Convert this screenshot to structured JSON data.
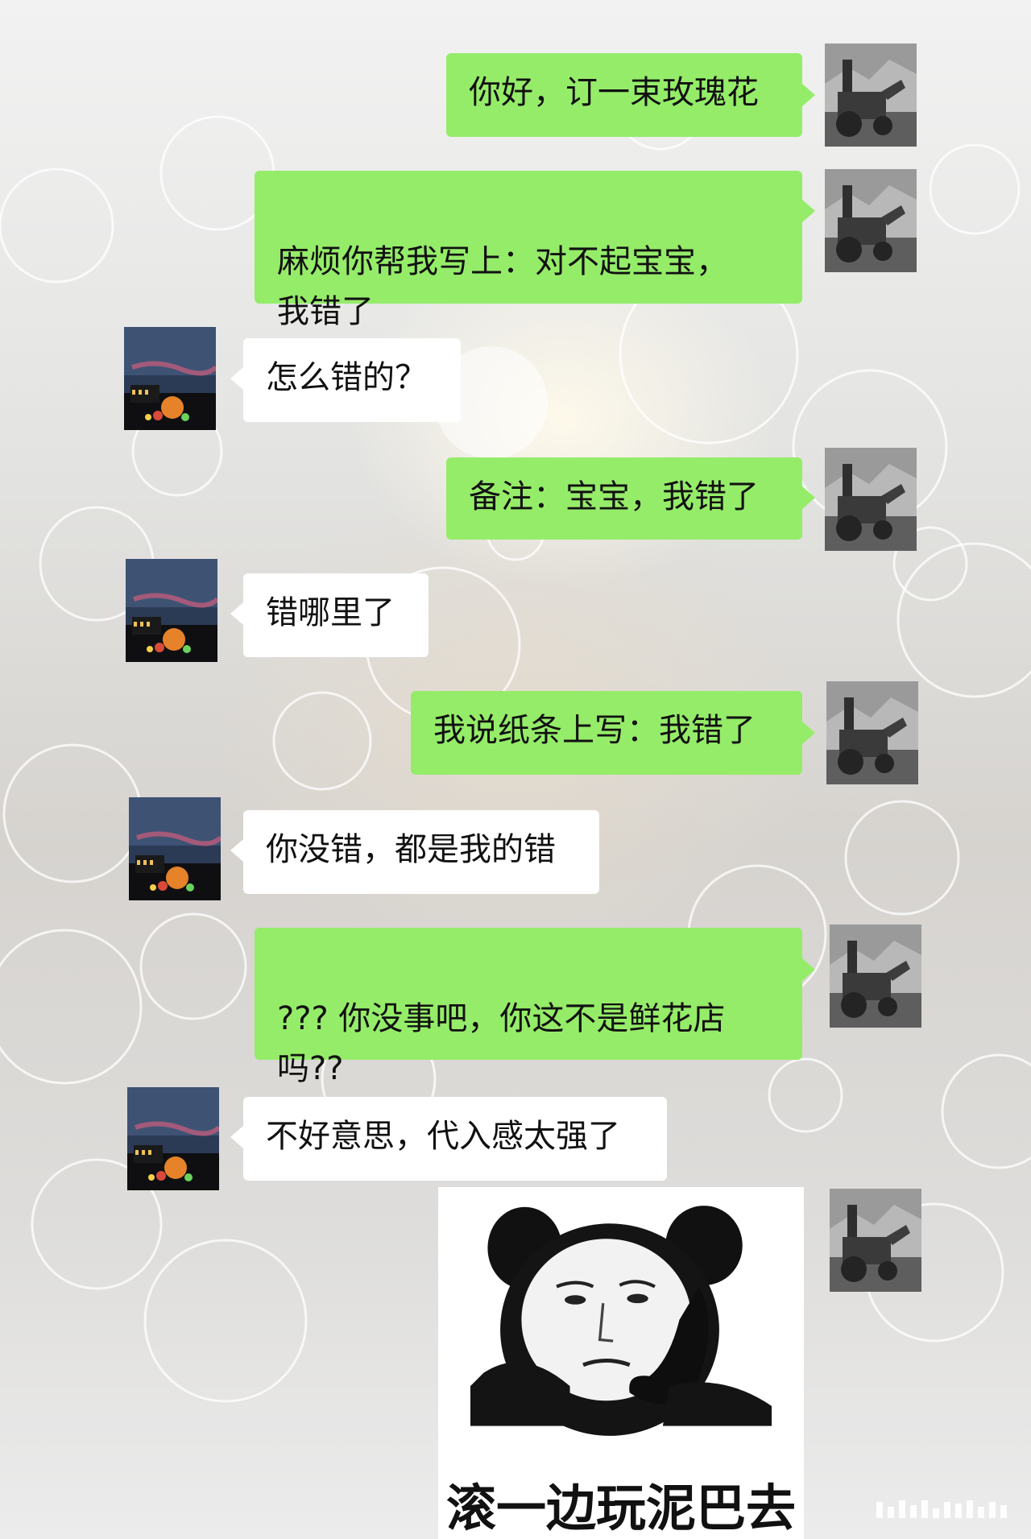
{
  "colors": {
    "self_bubble": "#95ec69",
    "other_bubble": "#ffffff",
    "text": "#111111"
  },
  "messages": [
    {
      "sender": "me",
      "text": "你好，订一束玫瑰花"
    },
    {
      "sender": "me",
      "text": "麻烦你帮我写上：对不起宝宝，\n我错了"
    },
    {
      "sender": "shop",
      "text": "怎么错的？"
    },
    {
      "sender": "me",
      "text": "备注：宝宝，我错了"
    },
    {
      "sender": "shop",
      "text": "错哪里了"
    },
    {
      "sender": "me",
      "text": "我说纸条上写：我错了"
    },
    {
      "sender": "shop",
      "text": "你没错，都是我的错"
    },
    {
      "sender": "me",
      "text": "??? 你没事吧，你这不是鲜花店\n吗??"
    },
    {
      "sender": "shop",
      "text": "不好意思，代入感太强了"
    }
  ],
  "sticker": {
    "sender": "me",
    "icon": "panda-meme-sticker",
    "caption": "滚一边玩泥巴去"
  },
  "avatars": {
    "me": "tractor-photo-avatar",
    "shop": "night-scene-avatar"
  }
}
